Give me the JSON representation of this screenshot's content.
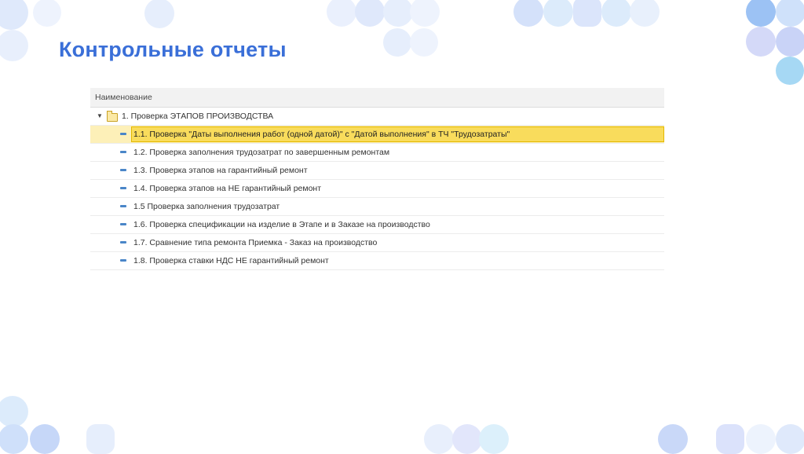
{
  "page": {
    "title": "Контрольные отчеты"
  },
  "tree": {
    "header": "Наименование",
    "group": {
      "label": "1. Проверка ЭТАПОВ ПРОИЗВОДСТВА",
      "expanded": true,
      "icon": "folder-icon"
    },
    "items": [
      {
        "label": "1.1.  Проверка \"Даты выполнения работ (одной датой)\" с \"Датой выполнения\" в ТЧ \"Трудозатраты\"",
        "selected": true
      },
      {
        "label": "1.2. Проверка заполнения трудозатрат по завершенным ремонтам"
      },
      {
        "label": "1.3. Проверка этапов на гарантийный ремонт"
      },
      {
        "label": "1.4. Проверка этапов на НЕ гарантийный ремонт"
      },
      {
        "label": "1.5 Проверка заполнения трудозатрат"
      },
      {
        "label": "1.6. Проверка спецификации на изделие в Этапе и в Заказе на производство"
      },
      {
        "label": "1.7. Сравнение типа ремонта Приемка - Заказ на производство"
      },
      {
        "label": "1.8. Проверка ставки НДС НЕ гарантийный ремонт"
      }
    ]
  },
  "colors": {
    "title": "#3a6fd8",
    "selection": "#f9dc5c",
    "item_icon": "#4a86c8"
  }
}
